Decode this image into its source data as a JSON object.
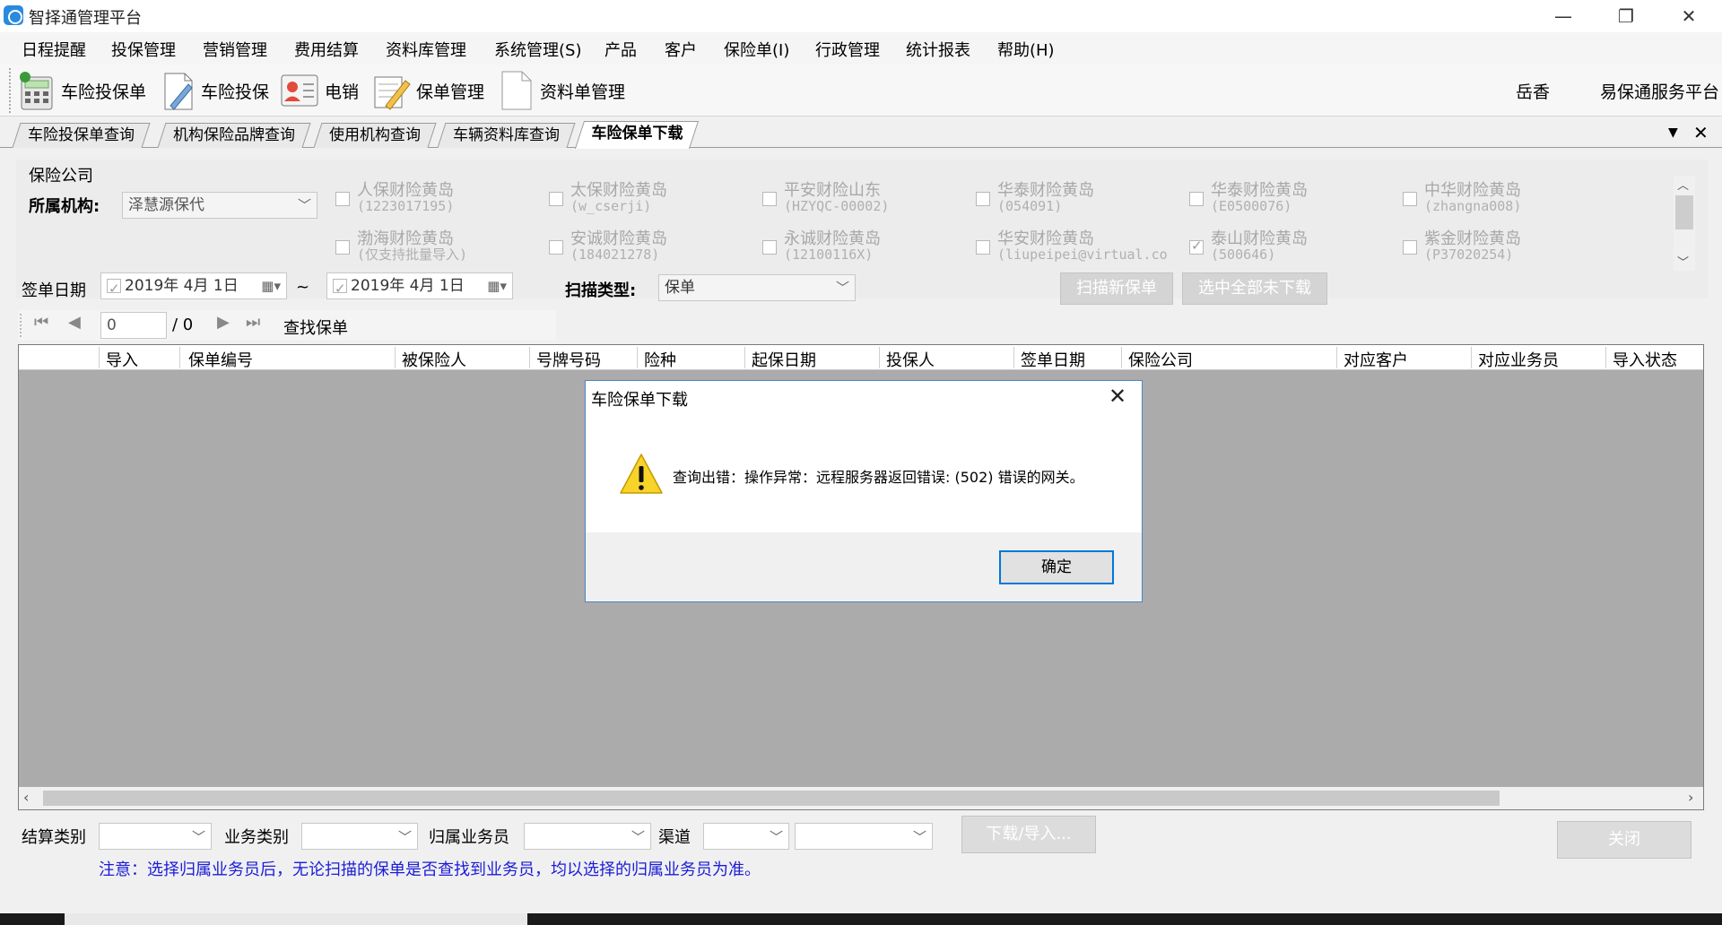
{
  "window": {
    "title": "智择通管理平台",
    "controls": [
      "—",
      "❐",
      "✕"
    ]
  },
  "menu": [
    "日程提醒",
    "投保管理",
    "营销管理",
    "费用结算",
    "资料库管理",
    "系统管理(S)",
    "产品",
    "客户",
    "保险单(I)",
    "行政管理",
    "统计报表",
    "帮助(H)"
  ],
  "toolbar": {
    "items": [
      {
        "label": "车险投保单",
        "icon": "calculator-icon"
      },
      {
        "label": "车险投保",
        "icon": "document-edit-icon"
      },
      {
        "label": "电销",
        "icon": "contact-card-icon"
      },
      {
        "label": "保单管理",
        "icon": "notepad-pen-icon"
      },
      {
        "label": "资料单管理",
        "icon": "blank-document-icon"
      }
    ],
    "user": "岳香",
    "service": "易保通服务平台"
  },
  "tabs": [
    "车险投保单查询",
    "机构保险品牌查询",
    "使用机构查询",
    "车辆资料库查询",
    "车险保单下载"
  ],
  "tab_controls": [
    "▼",
    "✕"
  ],
  "filter": {
    "group_label": "保险公司",
    "org_label": "所属机构:",
    "org_value": "泽慧源保代",
    "companies": [
      {
        "name": "人保财险黄岛",
        "code": "(1223017195)",
        "checked": false
      },
      {
        "name": "太保财险黄岛",
        "code": "(w_cserji)",
        "checked": false
      },
      {
        "name": "平安财险山东",
        "code": "(HZYQC-00002)",
        "checked": false
      },
      {
        "name": "华泰财险黄岛",
        "code": "(054091)",
        "checked": false
      },
      {
        "name": "华泰财险黄岛",
        "code": "(E0500076)",
        "checked": false
      },
      {
        "name": "中华财险黄岛",
        "code": "(zhangna008)",
        "checked": false
      },
      {
        "name": "渤海财险黄岛",
        "code": "(仅支持批量导入)",
        "checked": false
      },
      {
        "name": "安诚财险黄岛",
        "code": "(184021278)",
        "checked": false
      },
      {
        "name": "永诚财险黄岛",
        "code": "(12100116X)",
        "checked": false
      },
      {
        "name": "华安财险黄岛",
        "code": "(liupeipei@virtual.co",
        "checked": false
      },
      {
        "name": "泰山财险黄岛",
        "code": "(500646)",
        "checked": true
      },
      {
        "name": "紫金财险黄岛",
        "code": "(P37020254)",
        "checked": false
      }
    ],
    "date_label": "签单日期",
    "date_from": "2019年  4月  1日",
    "date_sep": "~",
    "date_to": "2019年  4月  1日",
    "scan_type_label": "扫描类型:",
    "scan_type_value": "保单",
    "scan_new_button": "扫描新保单",
    "select_all_button": "选中全部未下载"
  },
  "nav": {
    "page_value": "0",
    "page_total": "/ 0",
    "find_label": "查找保单"
  },
  "grid": {
    "columns": [
      "导入",
      "保单编号",
      "被保险人",
      "号牌号码",
      "险种",
      "起保日期",
      "投保人",
      "签单日期",
      "保险公司",
      "对应客户",
      "对应业务员",
      "导入状态"
    ]
  },
  "bottom": {
    "settle_label": "结算类别",
    "biz_label": "业务类别",
    "salesman_label": "归属业务员",
    "channel_label": "渠道",
    "download_button": "下载/导入...",
    "close_button": "关闭",
    "notice": "注意：选择归属业务员后，无论扫描的保单是否查找到业务员，均以选择的归属业务员为准。"
  },
  "dialog": {
    "title": "车险保单下载",
    "close": "✕",
    "message": "查询出错：操作异常：远程服务器返回错误: (502) 错误的网关。",
    "ok": "确定"
  }
}
